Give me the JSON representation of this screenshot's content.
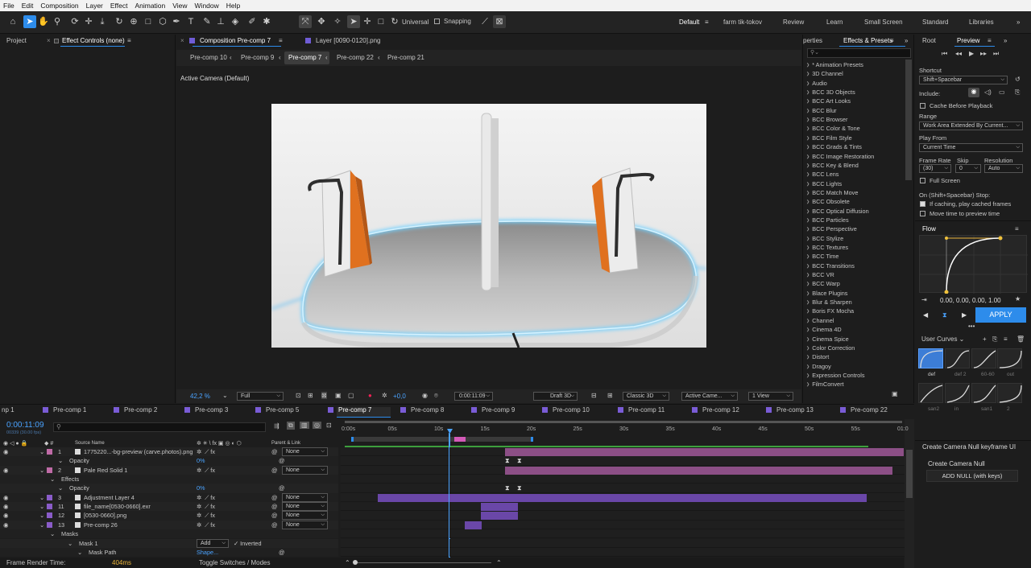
{
  "menu": [
    "File",
    "Edit",
    "Composition",
    "Layer",
    "Effect",
    "Animation",
    "View",
    "Window",
    "Help"
  ],
  "toolbar": {
    "universal": "Universal",
    "snapping": "Snapping"
  },
  "workspaces": [
    "Default",
    "farm tik-tokov",
    "Review",
    "Learn",
    "Small Screen",
    "Standard",
    "Libraries"
  ],
  "left_panel": {
    "project": "Project",
    "effect_controls": "Effect Controls (none)"
  },
  "viewer": {
    "comp_tab": "Composition Pre-comp 7",
    "layer_tab": "Layer [0090-0120].png",
    "breadcrumbs": [
      "Pre-comp 10",
      "Pre-comp 9",
      "Pre-comp 7",
      "Pre-comp 22",
      "Pre-comp 21"
    ],
    "camera_label": "Active Camera (Default)",
    "zoom": "42,2 %",
    "resolution": "Full",
    "exposure": "+0,0",
    "timecode": "0:00:11:09",
    "draft": "Draft 3D",
    "renderer": "Classic 3D",
    "camera": "Active Came...",
    "views": "1 View"
  },
  "effects_panel": {
    "properties_tab": "perties",
    "tab": "Effects & Presets",
    "search_placeholder": "",
    "items": [
      "* Animation Presets",
      "3D Channel",
      "Audio",
      "BCC 3D Objects",
      "BCC Art Looks",
      "BCC Blur",
      "BCC Browser",
      "BCC Color & Tone",
      "BCC Film Style",
      "BCC Grads & Tints",
      "BCC Image Restoration",
      "BCC Key & Blend",
      "BCC Lens",
      "BCC Lights",
      "BCC Match Move",
      "BCC Obsolete",
      "BCC Optical Diffusion",
      "BCC Particles",
      "BCC Perspective",
      "BCC Stylize",
      "BCC Textures",
      "BCC Time",
      "BCC Transitions",
      "BCC VR",
      "BCC Warp",
      "Blace Plugins",
      "Blur & Sharpen",
      "Boris FX Mocha",
      "Channel",
      "Cinema 4D",
      "Cinema Spice",
      "Color Correction",
      "Distort",
      "Dragoy",
      "Expression Controls",
      "FilmConvert"
    ]
  },
  "preview": {
    "root_tab": "Root",
    "tab": "Preview",
    "shortcut_label": "Shortcut",
    "shortcut": "Shift+Spacebar",
    "include_label": "Include:",
    "cache": "Cache Before Playback",
    "range_label": "Range",
    "range": "Work Area Extended By Current...",
    "play_from_label": "Play From",
    "play_from": "Current Time",
    "frame_rate_label": "Frame Rate",
    "frame_rate": "(30)",
    "skip_label": "Skip",
    "skip": "0",
    "resolution_label": "Resolution",
    "resolution": "Auto",
    "full_screen": "Full Screen",
    "stop_label": "On (Shift+Spacebar) Stop:",
    "if_caching": "If caching, play cached frames",
    "move_time": "Move time to preview time"
  },
  "flow": {
    "title": "Flow",
    "values": "0.00, 0.00, 0.00, 1.00",
    "apply": "APPLY",
    "user_curves": "User Curves",
    "presets": [
      "def",
      "def 2",
      "60-60",
      "out",
      "san2",
      "in",
      "san1",
      "2"
    ]
  },
  "null_panel": {
    "title": "Create Camera Null keyframe UI",
    "heading": "Create Camera Null",
    "button": "ADD NULL (with keys)"
  },
  "timeline": {
    "tabs": [
      "np 1",
      "Pre-comp 1",
      "Pre-comp 2",
      "Pre-comp 3",
      "Pre-comp 5",
      "Pre-comp 7",
      "Pre-comp 8",
      "Pre-comp 9",
      "Pre-comp 10",
      "Pre-comp 11",
      "Pre-comp 12",
      "Pre-comp 13",
      "Pre-comp 22"
    ],
    "timecode": "0:00:11:09",
    "timecode_sub": "00339 (30.00 fps)",
    "source_name": "Source Name",
    "parent_link": "Parent & Link",
    "ruler": [
      "0:00s",
      "05s",
      "10s",
      "15s",
      "20s",
      "25s",
      "30s",
      "35s",
      "40s",
      "45s",
      "50s",
      "55s",
      "01:0"
    ],
    "rows": [
      {
        "num": "1",
        "name": "1775220...-bg-preview (carve.photos).png",
        "parent": "None",
        "color": "#c06ba7"
      },
      {
        "num": "",
        "name": "Opacity",
        "value": "0%"
      },
      {
        "num": "2",
        "name": "Pale Red Solid 1",
        "parent": "None",
        "color": "#c06ba7"
      },
      {
        "num": "",
        "name": "Effects"
      },
      {
        "num": "",
        "name": "Opacity",
        "value": "0%"
      },
      {
        "num": "3",
        "name": "Adjustment Layer 4",
        "parent": "None",
        "color": "#8a5cc9"
      },
      {
        "num": "11",
        "name": "file_name[0530-0660].exr",
        "parent": "None",
        "color": "#8a5cc9"
      },
      {
        "num": "12",
        "name": "[0530-0660].png",
        "parent": "None",
        "color": "#8a5cc9"
      },
      {
        "num": "13",
        "name": "Pre-comp 26",
        "parent": "None",
        "color": "#8a5cc9"
      },
      {
        "num": "",
        "name": "Masks"
      },
      {
        "num": "",
        "name": "Mask 1",
        "mode": "Add",
        "inverted": "Inverted"
      },
      {
        "num": "",
        "name": "Mask Path",
        "value": "Shape..."
      }
    ],
    "render_time_label": "Frame Render Time:",
    "render_time": "404ms",
    "toggle": "Toggle Switches / Modes"
  },
  "colors": {
    "accent": "#2d8ceb",
    "label_pink": "#c06ba7",
    "label_purple": "#8a5cc9",
    "bar_pink": "#8c4f86",
    "bar_purple": "#6a47a8"
  }
}
